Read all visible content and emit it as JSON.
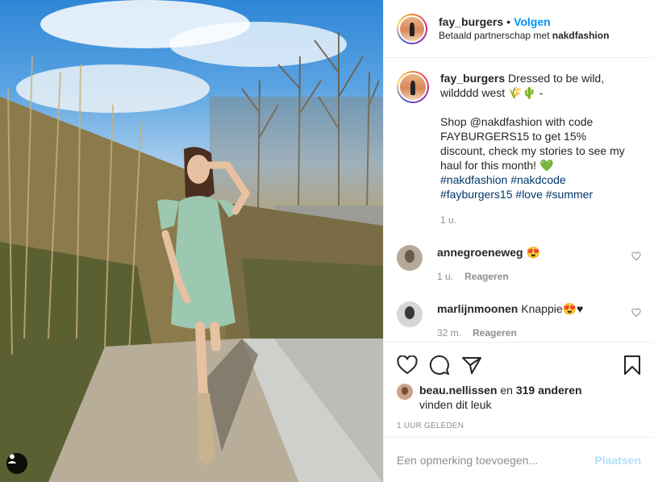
{
  "post": {
    "author": "fay_burgers",
    "follow_label": "Volgen",
    "separator": "•",
    "partnership_prefix": "Betaald partnerschap met ",
    "partner_name": "nakdfashion"
  },
  "caption": {
    "username": "fay_burgers",
    "text_1": "Dressed to be wild, wildddd west 🌾🌵 -",
    "text_2": "Shop @nakdfashion with code FAYBURGERS15 to get 15% discount, check my stories to see my haul for this month! 💚",
    "hashtags": [
      "#nakdfashion",
      "#nakdcode",
      "#fayburgers15",
      "#love",
      "#summer"
    ],
    "time": "1 u."
  },
  "comments": [
    {
      "username": "annegroeneweg",
      "text": "😍",
      "time": "1 u.",
      "reply_label": "Reageren"
    },
    {
      "username": "marlijnmoonen",
      "text": "Knappie😍♥",
      "time": "32 m.",
      "reply_label": "Reageren"
    }
  ],
  "likes": {
    "first_user": "beau.nellissen",
    "and": "en",
    "others": "319 anderen",
    "suffix": "vinden dit leuk"
  },
  "posted_time": "1 UUR GELEDEN",
  "comment_box": {
    "placeholder": "Een opmerking toevoegen...",
    "post_label": "Plaatsen"
  },
  "colors": {
    "link_blue": "#0095f6",
    "hashtag_blue": "#00376b",
    "muted_gray": "#8e8e8e",
    "post_disabled": "#b2dffc"
  }
}
